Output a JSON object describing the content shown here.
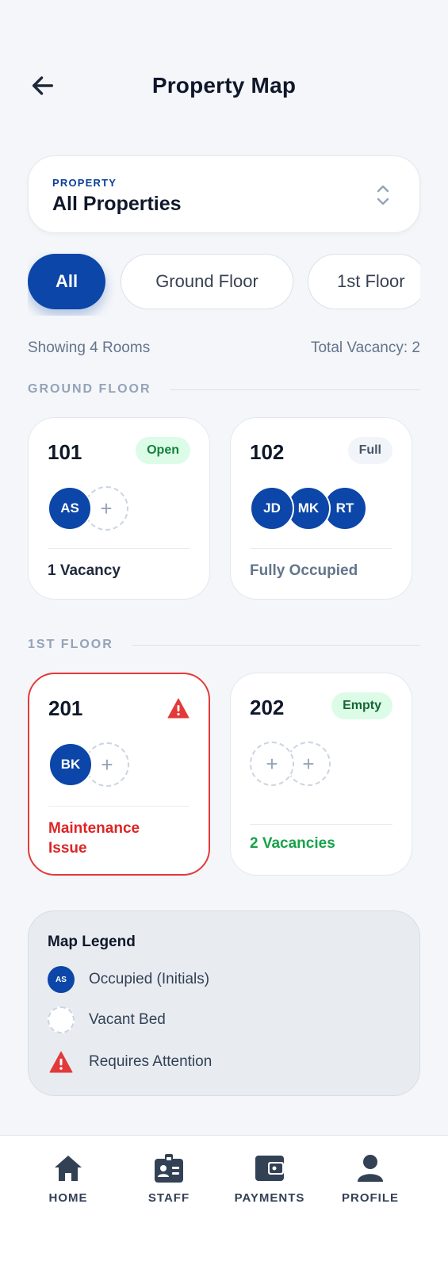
{
  "header": {
    "title": "Property Map",
    "back_icon": "arrow-left-icon"
  },
  "property_select": {
    "label": "PROPERTY",
    "value": "All Properties",
    "icon": "chevron-up-down-icon"
  },
  "filters": [
    {
      "label": "All",
      "active": true
    },
    {
      "label": "Ground Floor",
      "active": false
    },
    {
      "label": "1st Floor",
      "active": false
    }
  ],
  "summary": {
    "showing": "Showing 4 Rooms",
    "vacancy": "Total Vacancy: 2"
  },
  "sections": [
    {
      "title": "GROUND FLOOR",
      "rooms": [
        {
          "number": "101",
          "badge": "Open",
          "badge_type": "open",
          "occupants": [
            "AS"
          ],
          "vacant_beds": 1,
          "status": "1 Vacancy",
          "status_color": "#1e293b"
        },
        {
          "number": "102",
          "badge": "Full",
          "badge_type": "full",
          "occupants": [
            "JD",
            "MK",
            "RT"
          ],
          "vacant_beds": 0,
          "status": "Fully Occupied",
          "status_color": "#64748b"
        }
      ]
    },
    {
      "title": "1ST FLOOR",
      "rooms": [
        {
          "number": "201",
          "badge": "",
          "badge_type": "alert",
          "icon": "warning-triangle-icon",
          "occupants": [
            "BK"
          ],
          "vacant_beds": 1,
          "status_lines": [
            "Maintenance",
            "Issue"
          ],
          "status_color": "#dc2626"
        },
        {
          "number": "202",
          "badge": "Empty",
          "badge_type": "empty",
          "occupants": [],
          "vacant_beds": 2,
          "status": "2 Vacancies",
          "status_color": "#16a34a"
        }
      ]
    }
  ],
  "legend": {
    "title": "Map Legend",
    "items": [
      {
        "sample": "AS",
        "label": "Occupied (Initials)"
      },
      {
        "label": "Vacant Bed"
      },
      {
        "label": "Requires Attention"
      }
    ]
  },
  "nav": [
    {
      "label": "HOME",
      "icon": "home-icon"
    },
    {
      "label": "STAFF",
      "icon": "staff-badge-icon"
    },
    {
      "label": "PAYMENTS",
      "icon": "wallet-icon"
    },
    {
      "label": "PROFILE",
      "icon": "person-icon"
    }
  ],
  "colors": {
    "primary": "#0b46a8",
    "alert": "#e23a3a",
    "success": "#16a34a",
    "background": "#f4f6f9"
  }
}
